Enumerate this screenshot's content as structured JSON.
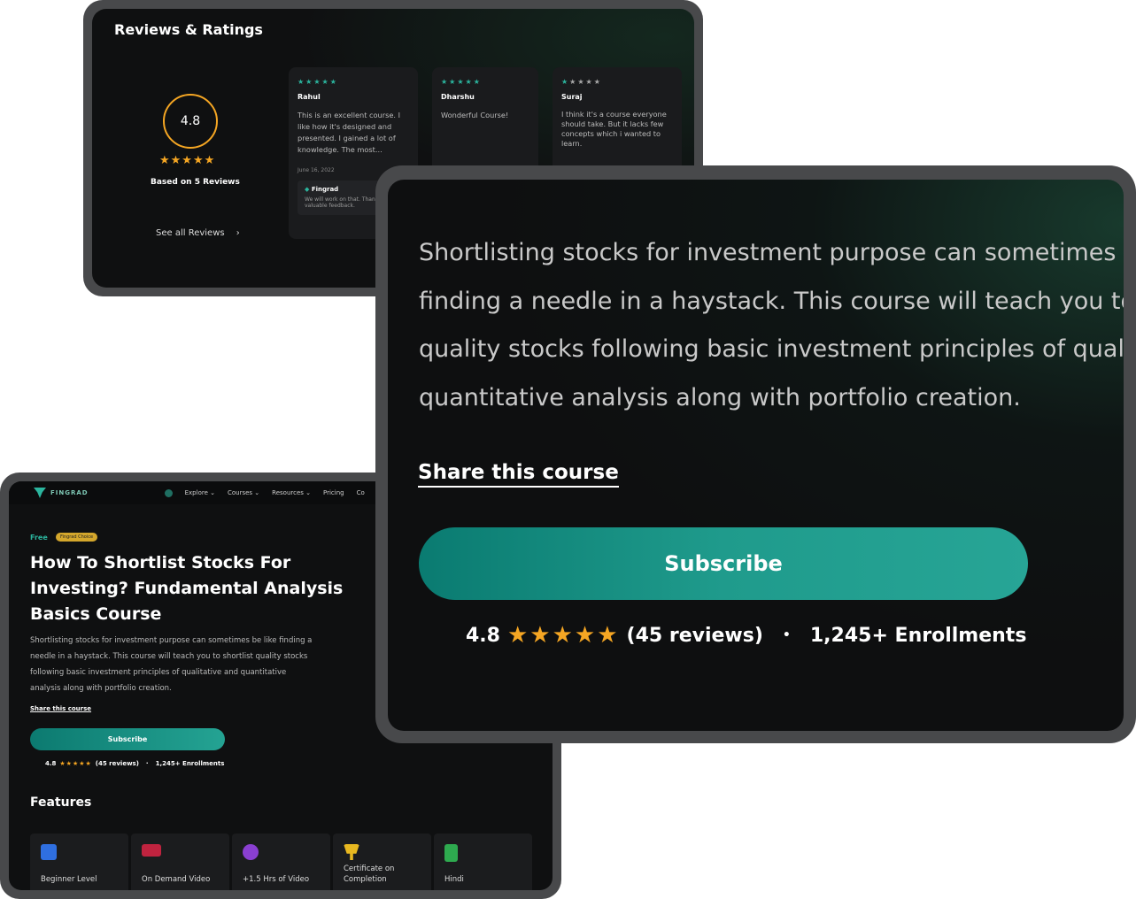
{
  "reviews": {
    "title": "Reviews & Ratings",
    "rating": "4.8",
    "stars": "★★★★★",
    "based_on": "Based on  5 Reviews",
    "see_all": "See all Reviews",
    "chevron": "›",
    "cards": [
      {
        "stars": "★★★★★",
        "name": "Rahul",
        "text": "This is an excellent course. I like how it's designed and presented. I gained a lot of knowledge. The most...",
        "date": "June 16, 2022",
        "reply_name": "Fingrad",
        "reply_text": "We will work on that. Thank valuable feedback."
      },
      {
        "stars": "★★★★★",
        "name": "Dharshu",
        "text": "Wonderful Course!"
      },
      {
        "stars_full": "★",
        "stars_dim": "★★★★",
        "name": "Suraj",
        "text": "I think it's a course everyone should take. But it lacks few concepts which i wanted to learn."
      }
    ]
  },
  "course_page": {
    "nav": {
      "logo": "FINGRAD",
      "items": [
        "Explore ⌄",
        "Courses ⌄",
        "Resources ⌄",
        "Pricing",
        "Co"
      ]
    },
    "free": "Free",
    "badge": "Fingrad Choice",
    "title": "How To Shortlist Stocks For Investing? Fundamental Analysis Basics Course",
    "description": "Shortlisting stocks for investment purpose can sometimes be like finding a needle in a haystack. This course will teach you to shortlist quality stocks following basic investment principles of qualitative and quantitative analysis along with portfolio creation.",
    "share": "Share this course",
    "subscribe": "Subscribe",
    "meta": {
      "rating": "4.8",
      "stars": "★★★★★",
      "reviews": "(45 reviews)",
      "dot": "·",
      "enrollments": "1,245+ Enrollments"
    },
    "features_title": "Features",
    "features": [
      {
        "label": "Beginner Level",
        "icon": "bar-chart-icon",
        "color": "#2f6fe0"
      },
      {
        "label": "On Demand Video",
        "icon": "video-icon",
        "color": "#c0233f"
      },
      {
        "label": "+1.5 Hrs of Video",
        "icon": "stopwatch-icon",
        "color": "#8a3fd1"
      },
      {
        "label": "Certificate on Completion",
        "icon": "trophy-icon",
        "color": "#e8b820"
      },
      {
        "label": "Hindi",
        "icon": "language-icon",
        "color": "#2eaa4f"
      }
    ]
  },
  "zoom": {
    "description_lines": [
      "Shortlisting stocks for investment purpose can sometimes be like",
      "finding a needle in a haystack. This course will teach you to shortlist",
      "quality stocks following basic investment principles of qualitative and",
      "quantitative analysis along with portfolio creation."
    ],
    "share": "Share this course",
    "subscribe": "Subscribe",
    "meta": {
      "rating": "4.8",
      "stars": "★★★★★",
      "reviews": "(45 reviews)",
      "dot": "•",
      "enrollments": "1,245+ Enrollments"
    }
  },
  "colors": {
    "accent": "#2bb59e",
    "star": "#f5a623",
    "bezel": "#48494b",
    "screen": "#0f1011"
  }
}
